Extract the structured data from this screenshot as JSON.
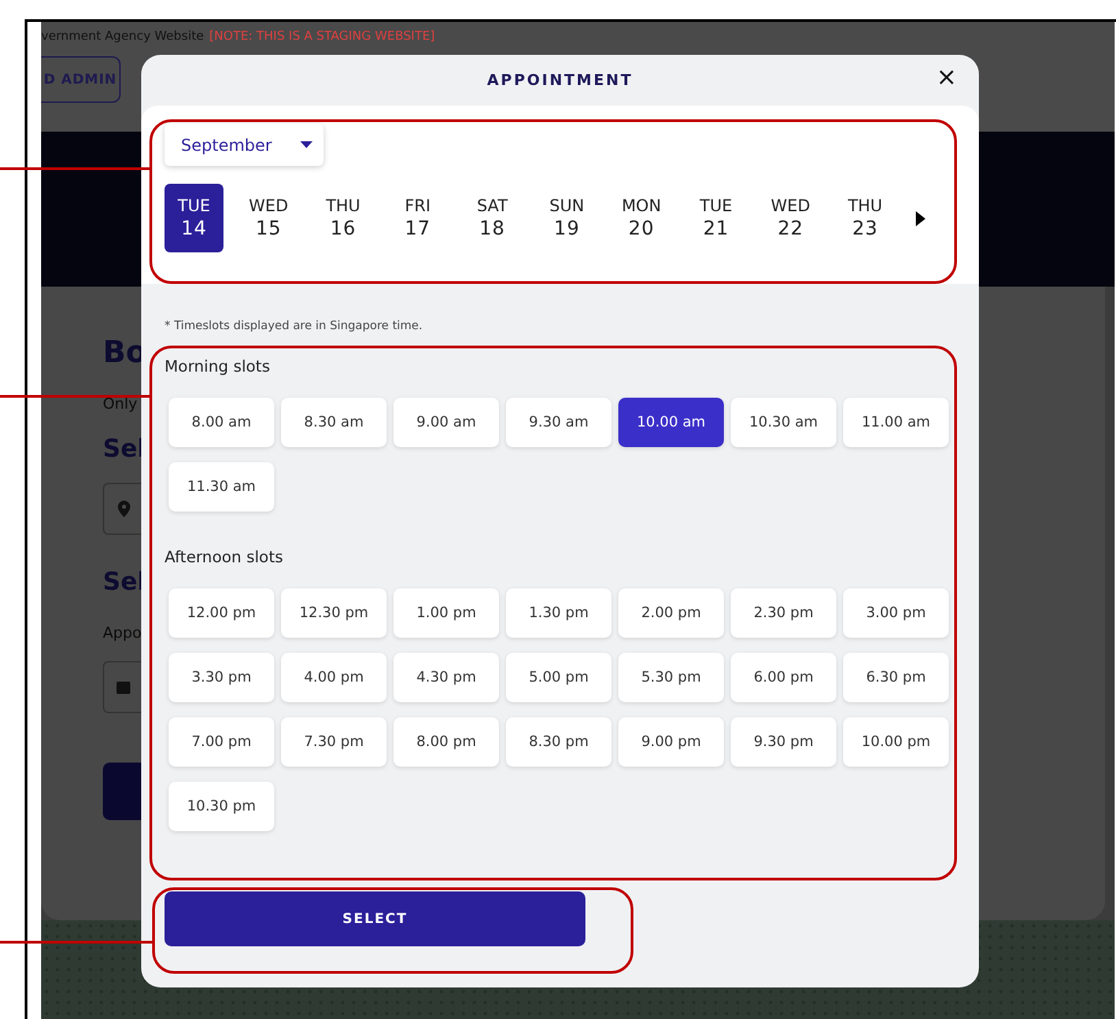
{
  "background_page": {
    "banner": "vernment Agency Website",
    "banner_note": "[NOTE: THIS IS A STAGING WEBSITE]",
    "admin_button": "D ADMIN",
    "texts": [
      "Bo",
      "Only",
      "Sel",
      "Sel",
      "Appo"
    ]
  },
  "modal": {
    "title": "APPOINTMENT",
    "close": "×",
    "month": "September",
    "days": [
      {
        "weekday": "TUE",
        "date": "14",
        "selected": true
      },
      {
        "weekday": "WED",
        "date": "15",
        "selected": false
      },
      {
        "weekday": "THU",
        "date": "16",
        "selected": false
      },
      {
        "weekday": "FRI",
        "date": "17",
        "selected": false
      },
      {
        "weekday": "SAT",
        "date": "18",
        "selected": false
      },
      {
        "weekday": "SUN",
        "date": "19",
        "selected": false
      },
      {
        "weekday": "MON",
        "date": "20",
        "selected": false
      },
      {
        "weekday": "TUE",
        "date": "21",
        "selected": false
      },
      {
        "weekday": "WED",
        "date": "22",
        "selected": false
      },
      {
        "weekday": "THU",
        "date": "23",
        "selected": false
      }
    ],
    "note": "* Timeslots displayed are in Singapore time.",
    "groups": [
      {
        "label": "Morning slots",
        "slots": [
          {
            "time": "8.00 am",
            "selected": false
          },
          {
            "time": "8.30 am",
            "selected": false
          },
          {
            "time": "9.00 am",
            "selected": false
          },
          {
            "time": "9.30 am",
            "selected": false
          },
          {
            "time": "10.00 am",
            "selected": true
          },
          {
            "time": "10.30 am",
            "selected": false
          },
          {
            "time": "11.00 am",
            "selected": false
          },
          {
            "time": "11.30 am",
            "selected": false
          }
        ]
      },
      {
        "label": "Afternoon slots",
        "slots": [
          {
            "time": "12.00 pm",
            "selected": false
          },
          {
            "time": "12.30 pm",
            "selected": false
          },
          {
            "time": "1.00 pm",
            "selected": false
          },
          {
            "time": "1.30 pm",
            "selected": false
          },
          {
            "time": "2.00 pm",
            "selected": false
          },
          {
            "time": "2.30 pm",
            "selected": false
          },
          {
            "time": "3.00 pm",
            "selected": false
          },
          {
            "time": "3.30 pm",
            "selected": false
          },
          {
            "time": "4.00 pm",
            "selected": false
          },
          {
            "time": "4.30 pm",
            "selected": false
          },
          {
            "time": "5.00 pm",
            "selected": false
          },
          {
            "time": "5.30 pm",
            "selected": false
          },
          {
            "time": "6.00 pm",
            "selected": false
          },
          {
            "time": "6.30 pm",
            "selected": false
          },
          {
            "time": "7.00 pm",
            "selected": false
          },
          {
            "time": "7.30 pm",
            "selected": false
          },
          {
            "time": "8.00 pm",
            "selected": false
          },
          {
            "time": "8.30 pm",
            "selected": false
          },
          {
            "time": "9.00 pm",
            "selected": false
          },
          {
            "time": "9.30 pm",
            "selected": false
          },
          {
            "time": "10.00 pm",
            "selected": false
          },
          {
            "time": "10.30 pm",
            "selected": false
          }
        ]
      }
    ],
    "select_button": "SELECT"
  }
}
